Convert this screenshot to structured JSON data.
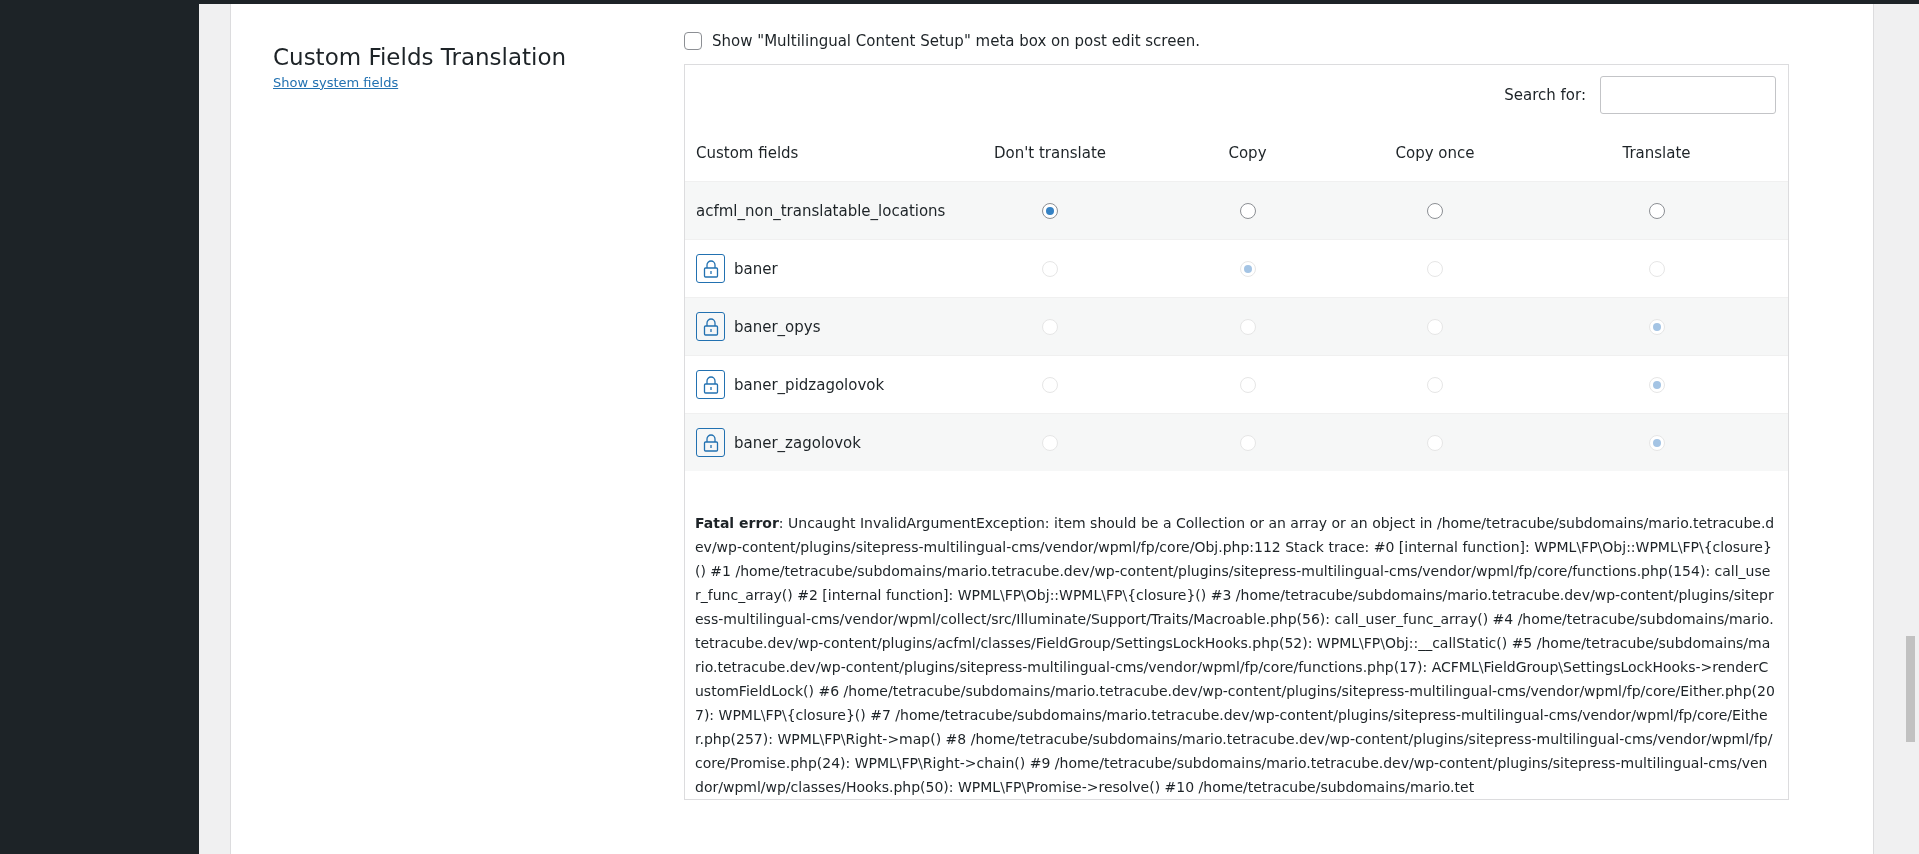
{
  "section": {
    "title": "Custom Fields Translation",
    "link": "Show system fields"
  },
  "meta_box_option": {
    "label": "Show \"Multilingual Content Setup\" meta box on post edit screen.",
    "checked": false
  },
  "search": {
    "label": "Search for:"
  },
  "table": {
    "columns": [
      "Custom fields",
      "Don't translate",
      "Copy",
      "Copy once",
      "Translate"
    ],
    "rows": [
      {
        "name": "acfml_non_translatable_locations",
        "locked": false,
        "options": [
          {
            "selected": true
          },
          {
            "selected": false
          },
          {
            "selected": false
          },
          {
            "selected": false
          }
        ]
      },
      {
        "name": "baner",
        "locked": true,
        "options": [
          {
            "selected": false
          },
          {
            "selected": true
          },
          {
            "selected": false
          },
          {
            "selected": false
          }
        ]
      },
      {
        "name": "baner_opys",
        "locked": true,
        "options": [
          {
            "selected": false
          },
          {
            "selected": false
          },
          {
            "selected": false
          },
          {
            "selected": true
          }
        ]
      },
      {
        "name": "baner_pidzagolovok",
        "locked": true,
        "options": [
          {
            "selected": false
          },
          {
            "selected": false
          },
          {
            "selected": false
          },
          {
            "selected": true
          }
        ]
      },
      {
        "name": "baner_zagolovok",
        "locked": true,
        "options": [
          {
            "selected": false
          },
          {
            "selected": false
          },
          {
            "selected": false
          },
          {
            "selected": true
          }
        ]
      }
    ]
  },
  "error_message": "**Fatal error**: Uncaught InvalidArgumentException: item should be a Collection or an array or an object in /home/tetracube/subdomains/mario.tetracube.dev/wp-content/plugins/sitepress-multilingual-cms/vendor/wpml/fp/core/Obj.php:112 Stack trace: #0 [internal function]: WPML\\FP\\Obj::WPML\\FP\\{closure}() #1 /home/tetracube/subdomains/mario.tetracube.dev/wp-content/plugins/sitepress-multilingual-cms/vendor/wpml/fp/core/functions.php(154): call_user_func_array() #2 [internal function]: WPML\\FP\\Obj::WPML\\FP\\{closure}() #3 /home/tetracube/subdomains/mario.tetracube.dev/wp-content/plugins/sitepress-multilingual-cms/vendor/wpml/collect/src/Illuminate/Support/Traits/Macroable.php(56): call_user_func_array() #4 /home/tetracube/subdomains/mario.tetracube.dev/wp-content/plugins/acfml/classes/FieldGroup/SettingsLockHooks.php(52): WPML\\FP\\Obj::__callStatic() #5 /home/tetracube/subdomains/mario.tetracube.dev/wp-content/plugins/sitepress-multilingual-cms/vendor/wpml/fp/core/functions.php(17): ACFML\\FieldGroup\\SettingsLockHooks->renderCustomFieldLock() #6 /home/tetracube/subdomains/mario.tetracube.dev/wp-content/plugins/sitepress-multilingual-cms/vendor/wpml/fp/core/Either.php(207): WPML\\FP\\{closure}() #7 /home/tetracube/subdomains/mario.tetracube.dev/wp-content/plugins/sitepress-multilingual-cms/vendor/wpml/fp/core/Either.php(257): WPML\\FP\\Right->map() #8 /home/tetracube/subdomains/mario.tetracube.dev/wp-content/plugins/sitepress-multilingual-cms/vendor/wpml/fp/core/Promise.php(24): WPML\\FP\\Right->chain() #9 /home/tetracube/subdomains/mario.tetracube.dev/wp-content/plugins/sitepress-multilingual-cms/vendor/wpml/wp/classes/Hooks.php(50): WPML\\FP\\Promise->resolve() #10 /home/tetracube/subdomains/mario.tet"
}
